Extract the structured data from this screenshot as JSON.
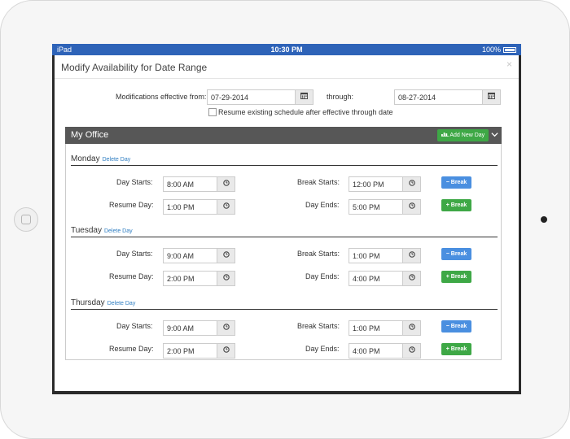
{
  "device": {
    "carrier": "iPad",
    "time": "10:30 PM",
    "battery": "100%"
  },
  "modal": {
    "title": "Modify Availability for Date Range",
    "close_glyph": "×",
    "effective_from_label": "Modifications effective from:",
    "effective_from_value": "07-29-2014",
    "through_label": "through:",
    "through_value": "08-27-2014",
    "resume_checkbox_label": "Resume existing schedule after effective through date",
    "resume_checked": false
  },
  "office": {
    "title": "My Office",
    "add_day_label": "Add New Day",
    "days": [
      {
        "name": "Monday",
        "delete_label": "Delete Day",
        "day_starts_label": "Day Starts:",
        "day_starts": "8:00 AM",
        "break_starts_label": "Break Starts:",
        "break_starts": "12:00 PM",
        "resume_label": "Resume Day:",
        "resume": "1:00 PM",
        "day_ends_label": "Day Ends:",
        "day_ends": "5:00 PM",
        "remove_break_label": "Break",
        "add_break_label": "Break"
      },
      {
        "name": "Tuesday",
        "delete_label": "Delete Day",
        "day_starts_label": "Day Starts:",
        "day_starts": "9:00 AM",
        "break_starts_label": "Break Starts:",
        "break_starts": "1:00 PM",
        "resume_label": "Resume Day:",
        "resume": "2:00 PM",
        "day_ends_label": "Day Ends:",
        "day_ends": "4:00 PM",
        "remove_break_label": "Break",
        "add_break_label": "Break"
      },
      {
        "name": "Thursday",
        "delete_label": "Delete Day",
        "day_starts_label": "Day Starts:",
        "day_starts": "9:00 AM",
        "break_starts_label": "Break Starts:",
        "break_starts": "1:00 PM",
        "resume_label": "Resume Day:",
        "resume": "2:00 PM",
        "day_ends_label": "Day Ends:",
        "day_ends": "4:00 PM",
        "remove_break_label": "Break",
        "add_break_label": "Break"
      }
    ]
  },
  "icons": {
    "calendar": "calendar-icon",
    "clock": "clock-icon",
    "minus": "minus-icon",
    "plus": "plus-icon",
    "chevron": "chevron-down-icon",
    "add_day": "calendar-add-icon"
  },
  "colors": {
    "status_bar": "#2e63b8",
    "header_bar": "#575757",
    "primary_button": "#4a8fe0",
    "success_button": "#3ea846",
    "link": "#2e7dc1"
  }
}
